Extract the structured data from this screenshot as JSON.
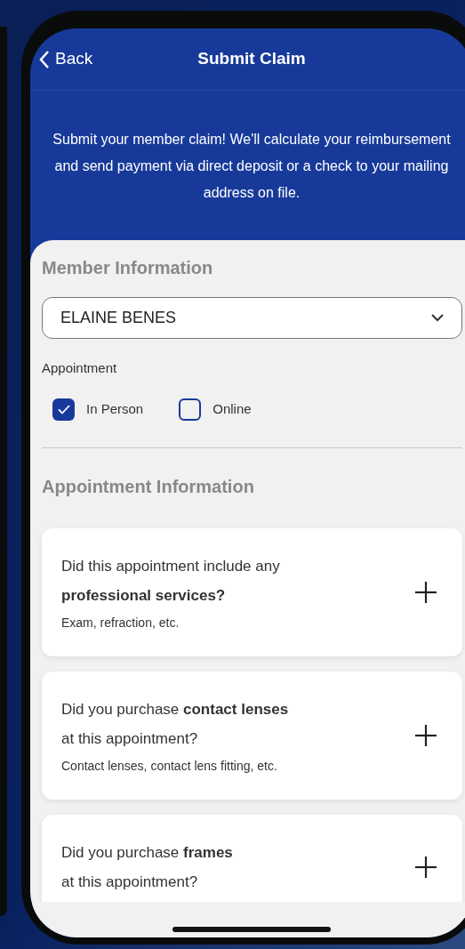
{
  "nav": {
    "back": "Back",
    "title": "Submit Claim"
  },
  "intro": "Submit your member claim! We'll calculate your reimbursement and send payment via direct deposit or a check to your mailing address on file.",
  "member": {
    "heading": "Member Information",
    "select_value": "ELAINE BENES",
    "appointment_label": "Appointment",
    "options": [
      {
        "label": "In Person",
        "checked": true
      },
      {
        "label": "Online",
        "checked": false
      }
    ]
  },
  "appointment": {
    "heading": "Appointment Information",
    "cards": [
      {
        "question": "Did this appointment include any\n**professional services?**",
        "hint": "Exam, refraction, etc.",
        "expanded": false
      },
      {
        "question": "Did you purchase **contact lenses**\nat this appointment?",
        "hint": "Contact lenses, contact lens fitting, etc.",
        "expanded": false
      },
      {
        "question": "Did you purchase **frames**\nat this appointment?",
        "expanded": false
      }
    ]
  }
}
